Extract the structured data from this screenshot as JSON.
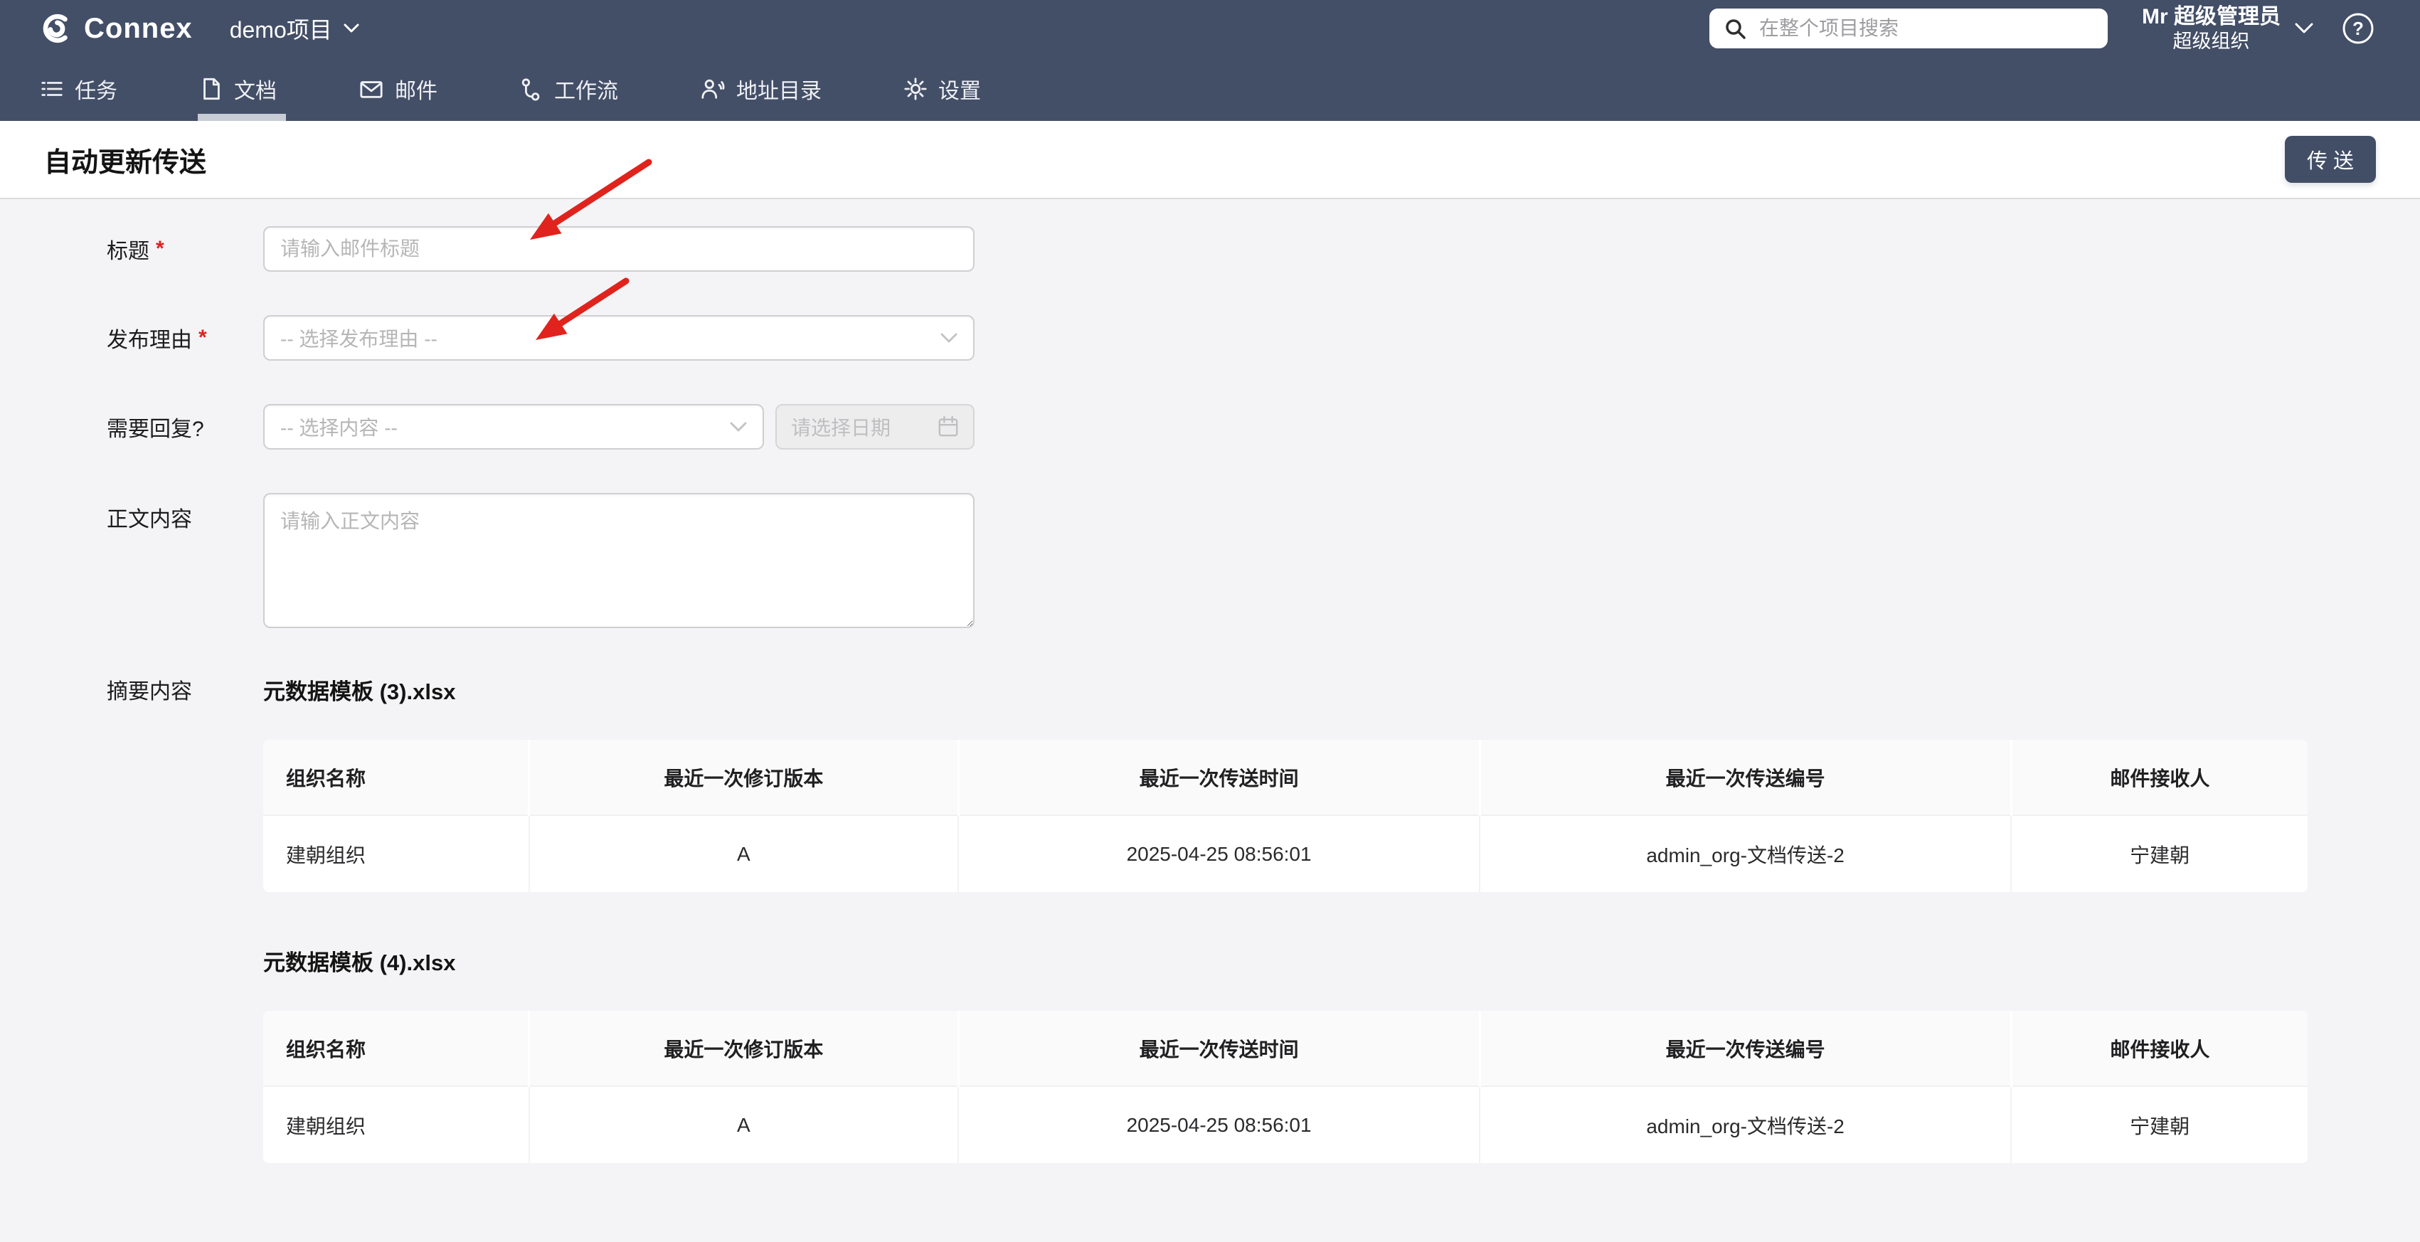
{
  "topbar": {
    "brand": "Connex",
    "project": "demo项目",
    "search_placeholder": "在整个项目搜索",
    "user_name": "Mr 超级管理员",
    "user_org": "超级组织"
  },
  "nav": {
    "tabs": [
      {
        "label": "任务",
        "icon": "list-icon",
        "active": false
      },
      {
        "label": "文档",
        "icon": "document-icon",
        "active": true
      },
      {
        "label": "邮件",
        "icon": "mail-icon",
        "active": false
      },
      {
        "label": "工作流",
        "icon": "workflow-icon",
        "active": false
      },
      {
        "label": "地址目录",
        "icon": "address-book-icon",
        "active": false
      },
      {
        "label": "设置",
        "icon": "gear-icon",
        "active": false
      }
    ]
  },
  "page": {
    "title": "自动更新传送",
    "send_button": "传 送"
  },
  "form": {
    "required_mark": "*",
    "title": {
      "label": "标题",
      "placeholder": "请输入邮件标题"
    },
    "reason": {
      "label": "发布理由",
      "placeholder": "-- 选择发布理由 --"
    },
    "reply": {
      "label": "需要回复?",
      "select_placeholder": "-- 选择内容 --",
      "date_placeholder": "请选择日期"
    },
    "body": {
      "label": "正文内容",
      "placeholder": "请输入正文内容"
    },
    "summary_label": "摘要内容"
  },
  "tables": [
    {
      "file_name": "元数据模板 (3).xlsx",
      "columns": [
        "组织名称",
        "最近一次修订版本",
        "最近一次传送时间",
        "最近一次传送编号",
        "邮件接收人"
      ],
      "rows": [
        [
          "建朝组织",
          "A",
          "2025-04-25 08:56:01",
          "admin_org-文档传送-2",
          "宁建朝"
        ]
      ]
    },
    {
      "file_name": "元数据模板 (4).xlsx",
      "columns": [
        "组织名称",
        "最近一次修订版本",
        "最近一次传送时间",
        "最近一次传送编号",
        "邮件接收人"
      ],
      "rows": [
        [
          "建朝组织",
          "A",
          "2025-04-25 08:56:01",
          "admin_org-文档传送-2",
          "宁建朝"
        ]
      ]
    }
  ],
  "icons": {
    "logo": "connex-logo-icon",
    "search": "search-icon",
    "help": "help-circle-icon",
    "project_chevron": "chevron-down-icon",
    "select_chevron": "chevron-down-icon",
    "date": "calendar-icon",
    "tabs": [
      "list-icon",
      "document-icon",
      "mail-icon",
      "workflow-icon",
      "address-book-icon",
      "gear-icon"
    ]
  },
  "colors": {
    "navbar": "#434e67",
    "primary_button": "#414e66",
    "tab_underline": "#c7ccd5",
    "content_bg": "#f4f4f6",
    "table_header_bg": "#fafafa",
    "annotation_red": "#e0231c",
    "required_red": "#e02020"
  }
}
